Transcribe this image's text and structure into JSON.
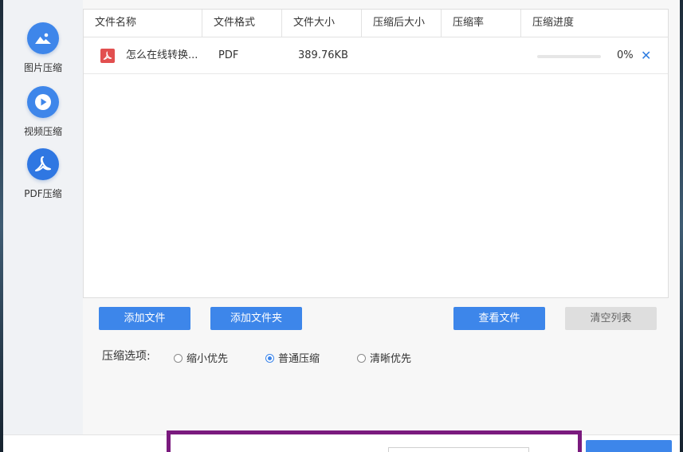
{
  "sidebar": {
    "items": [
      {
        "label": "图片压缩",
        "icon": "image-icon"
      },
      {
        "label": "视频压缩",
        "icon": "play-icon"
      },
      {
        "label": "PDF压缩",
        "icon": "pdf-icon"
      }
    ]
  },
  "table": {
    "headers": [
      "文件名称",
      "文件格式",
      "文件大小",
      "压缩后大小",
      "压缩率",
      "压缩进度"
    ],
    "rows": [
      {
        "name": "怎么在线转换...",
        "format": "PDF",
        "size": "389.76KB",
        "compressed_size": "",
        "ratio": "",
        "progress_text": "0%",
        "progress_value": 0
      }
    ]
  },
  "buttons": {
    "add_file": "添加文件",
    "add_folder": "添加文件夹",
    "view_files": "查看文件",
    "clear_list": "清空列表"
  },
  "options": {
    "label": "压缩选项:",
    "choices": [
      "缩小优先",
      "普通压缩",
      "清晰优先"
    ],
    "selected": "普通压缩"
  },
  "colors": {
    "accent": "#3d86ea",
    "highlight_border": "#7a1a7e",
    "pdf_red": "#e24f4f"
  }
}
